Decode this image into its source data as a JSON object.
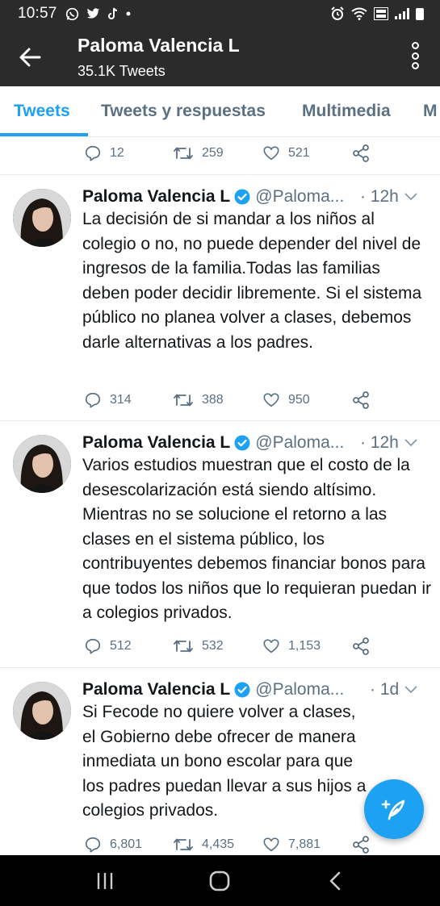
{
  "status_bar": {
    "time": "10:57",
    "left_icons": [
      "whatsapp-icon",
      "twitter-icon",
      "tiktok-icon",
      "dot-icon"
    ],
    "right_icons": [
      "alarm-icon",
      "wifi-icon",
      "volte-icon",
      "signal-icon",
      "battery-icon"
    ]
  },
  "header": {
    "title": "Paloma Valencia L",
    "subtitle": "35.1K Tweets",
    "back_icon": "arrow-left-icon",
    "more_icon": "more-vertical-icon"
  },
  "tabs": [
    {
      "label": "Tweets",
      "active": true
    },
    {
      "label": "Tweets y respuestas",
      "active": false
    },
    {
      "label": "Multimedia",
      "active": false
    },
    {
      "label": "M",
      "active": false
    }
  ],
  "top_actions": {
    "replies": "12",
    "retweets": "259",
    "likes": "521"
  },
  "tweets": [
    {
      "name": "Paloma Valencia L",
      "handle": "@Paloma...",
      "time": "· 12h",
      "text": "La decisión de si mandar a los niños al colegio o no, no puede depender del nivel de ingresos de la familia.Todas las familias deben poder decidir libremente. Si el sistema público no planea volver a clases, debemos darle alternativas a los padres.",
      "replies": "314",
      "retweets": "388",
      "likes": "950"
    },
    {
      "name": "Paloma Valencia L",
      "handle": "@Paloma...",
      "time": "· 12h",
      "text": "Varios estudios muestran que el costo de la desescolarización está siendo altísimo. Mientras no se solucione el retorno a las clases en el sistema público, los contribuyentes debemos financiar bonos para que todos los niños que lo requieran puedan ir a colegios privados.",
      "replies": "512",
      "retweets": "532",
      "likes": "1,153"
    },
    {
      "name": "Paloma Valencia L",
      "handle": "@Paloma...",
      "time": "· 1d",
      "text": "Si Fecode no quiere volver a clases, el Gobierno debe ofrecer de manera inmediata un bono escolar para que los padres puedan llevar a sus hijos a colegios privados.",
      "replies": "6,801",
      "retweets": "4,435",
      "likes": "7,881"
    }
  ],
  "fab_icon": "compose-tweet-icon",
  "nav": [
    "recent-apps-icon",
    "home-icon",
    "back-icon"
  ],
  "colors": {
    "accent": "#1da1f2",
    "header_bg": "#2b2b2b",
    "muted": "#5b7083",
    "text": "#14171a"
  }
}
